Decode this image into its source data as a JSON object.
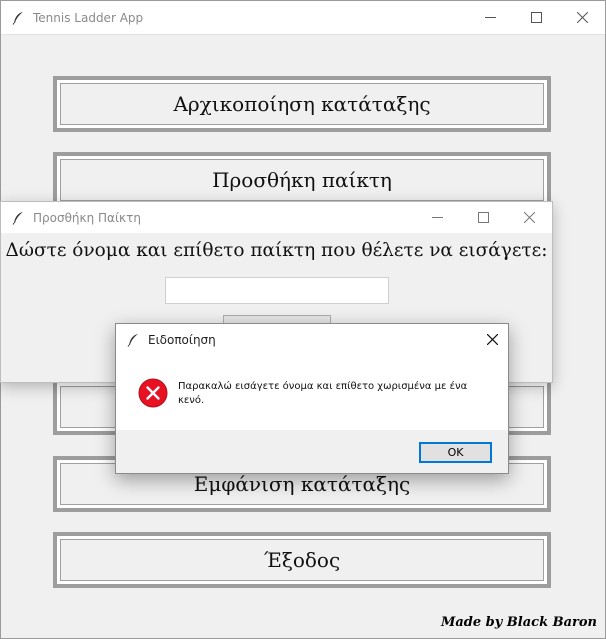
{
  "main_window": {
    "title": "Tennis Ladder App",
    "buttons": [
      {
        "label": "Αρχικοποίηση κατάταξης"
      },
      {
        "label": "Προσθήκη παίκτη"
      },
      {
        "label": ""
      },
      {
        "label": ""
      },
      {
        "label": "Εμφάνιση κατάταξης"
      },
      {
        "label": "Έξοδος"
      }
    ],
    "credit": "Made by Black Baron"
  },
  "add_player_window": {
    "title": "Προσθήκη Παίκτη",
    "prompt": "Δώστε όνομα και επίθετο παίκτη που θέλετε να εισάγετε:",
    "name_value": ""
  },
  "message_box": {
    "title": "Ειδοποίηση",
    "message": "Παρακαλώ εισάγετε όνομα και επίθετο χωρισμένα με ένα κενό.",
    "ok_label": "OK",
    "icon": "error-icon"
  },
  "colors": {
    "error_red": "#e81123",
    "ok_focus_border": "#0078d7"
  }
}
